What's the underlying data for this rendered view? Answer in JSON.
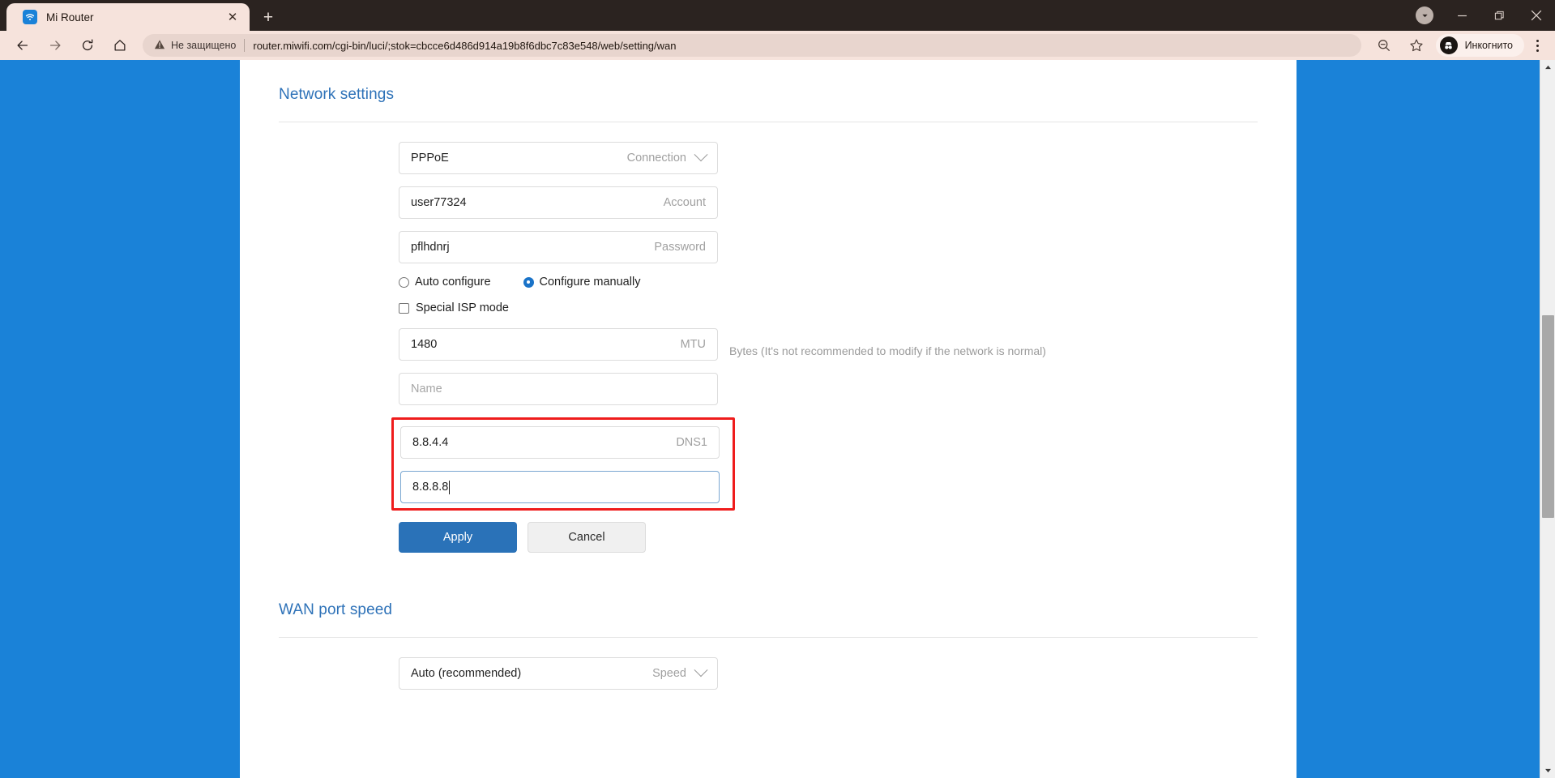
{
  "browser": {
    "tab": {
      "title": "Mi Router",
      "favicon": "wifi-icon",
      "close": "✕"
    },
    "new_tab": "+",
    "window_controls": {
      "downloads": "▼",
      "minimize": "—",
      "maximize": "❐",
      "close": "✕"
    },
    "nav": {
      "back": "←",
      "forward": "→",
      "reload": "↻",
      "home": "⌂"
    },
    "omnibox": {
      "warning_icon": "warning-triangle-icon",
      "security_label": "Не защищено",
      "url": "router.miwifi.com/cgi-bin/luci/;stok=cbcce6d486d914a19b8f6dbc7c83e548/web/setting/wan",
      "zoom_icon": "zoom-out-icon",
      "bookmark_icon": "star-icon"
    },
    "incognito": {
      "label": "Инкогнито",
      "icon": "incognito-hat-icon"
    },
    "menu": "three-dots-icon"
  },
  "page": {
    "network_settings": {
      "title": "Network settings",
      "connection": {
        "value": "PPPoE",
        "label": "Connection"
      },
      "account": {
        "value": "user77324",
        "label": "Account"
      },
      "password": {
        "value": "pflhdnrj",
        "label": "Password"
      },
      "config_mode": {
        "auto": "Auto configure",
        "manual": "Configure manually",
        "selected": "manual"
      },
      "special_isp": {
        "label": "Special ISP mode",
        "checked": false
      },
      "mtu": {
        "value": "1480",
        "label": "MTU",
        "hint": "Bytes (It's not recommended to modify if the network is normal)"
      },
      "name": {
        "value": "",
        "placeholder": "Name"
      },
      "dns1": {
        "value": "8.8.4.4",
        "label": "DNS1"
      },
      "dns2": {
        "value": "8.8.8.8",
        "label": "",
        "focused": true
      },
      "apply_label": "Apply",
      "cancel_label": "Cancel",
      "highlight_color": "#ef1c1c"
    },
    "wan_port_speed": {
      "title": "WAN port speed",
      "speed": {
        "value": "Auto (recommended)",
        "label": "Speed"
      }
    },
    "accent_color": "#2e72b8",
    "background_color": "#1a82d8"
  }
}
